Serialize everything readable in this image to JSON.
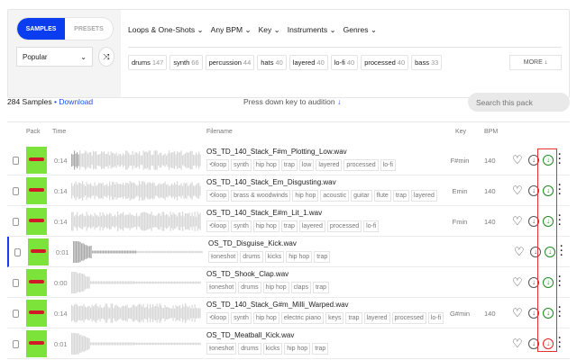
{
  "tabs": {
    "samples": "SAMPLES",
    "presets": "PRESETS"
  },
  "sort": {
    "value": "Popular"
  },
  "filters": [
    "Loops & One-Shots",
    "Any BPM",
    "Key",
    "Instruments",
    "Genres"
  ],
  "tags": [
    {
      "name": "drums",
      "count": "147"
    },
    {
      "name": "synth",
      "count": "66"
    },
    {
      "name": "percussion",
      "count": "44"
    },
    {
      "name": "hats",
      "count": "40"
    },
    {
      "name": "layered",
      "count": "40"
    },
    {
      "name": "lo-fi",
      "count": "40"
    },
    {
      "name": "processed",
      "count": "40"
    },
    {
      "name": "bass",
      "count": "33"
    }
  ],
  "more_label": "MORE ↓",
  "count_label": "284 Samples",
  "separator": " • ",
  "download_link": "Download",
  "hint": "Press down key to audition",
  "hint_arrow": "↓",
  "search_placeholder": "Search this pack",
  "columns": {
    "pack": "Pack",
    "time": "Time",
    "filename": "Filename",
    "key": "Key",
    "bpm": "BPM"
  },
  "rows": [
    {
      "time": "0:14",
      "name": "OS_TD_140_Stack_F#m_Plotting_Low.wav",
      "type": "loop",
      "tags": [
        "synth",
        "hip hop",
        "trap",
        "low",
        "layered",
        "processed",
        "lo-fi"
      ],
      "key": "F#min",
      "bpm": "140",
      "kind": "loop"
    },
    {
      "time": "0:14",
      "name": "OS_TD_140_Stack_Em_Disgusting.wav",
      "type": "loop",
      "tags": [
        "brass & woodwinds",
        "hip hop",
        "acoustic",
        "guitar",
        "flute",
        "trap",
        "layered"
      ],
      "key": "Emin",
      "bpm": "140",
      "kind": "loop"
    },
    {
      "time": "0:14",
      "name": "OS_TD_140_Stack_E#m_Lit_1.wav",
      "type": "loop",
      "tags": [
        "synth",
        "hip hop",
        "trap",
        "layered",
        "processed",
        "lo-fi"
      ],
      "key": "Fmin",
      "bpm": "140",
      "kind": "loop"
    },
    {
      "time": "0:01",
      "name": "OS_TD_Disguise_Kick.wav",
      "type": "oneshot",
      "tags": [
        "drums",
        "kicks",
        "hip hop",
        "trap"
      ],
      "key": "",
      "bpm": "",
      "kind": "shot"
    },
    {
      "time": "0:00",
      "name": "OS_TD_Shook_Clap.wav",
      "type": "oneshot",
      "tags": [
        "drums",
        "hip hop",
        "claps",
        "trap"
      ],
      "key": "",
      "bpm": "",
      "kind": "shot"
    },
    {
      "time": "0:14",
      "name": "OS_TD_140_Stack_G#m_Milli_Warped.wav",
      "type": "loop",
      "tags": [
        "synth",
        "hip hop",
        "electric piano",
        "keys",
        "trap",
        "layered",
        "processed",
        "lo-fi"
      ],
      "key": "G#min",
      "bpm": "140",
      "kind": "loop"
    },
    {
      "time": "0:01",
      "name": "OS_TD_Meatball_Kick.wav",
      "type": "oneshot",
      "tags": [
        "drums",
        "kicks",
        "hip hop",
        "trap"
      ],
      "key": "",
      "bpm": "",
      "kind": "shot"
    }
  ],
  "colors": {
    "accent": "#0a3cf0",
    "thumb": "#7be33a",
    "download_green": "#1d8a1d",
    "highlight": "#e53030"
  }
}
